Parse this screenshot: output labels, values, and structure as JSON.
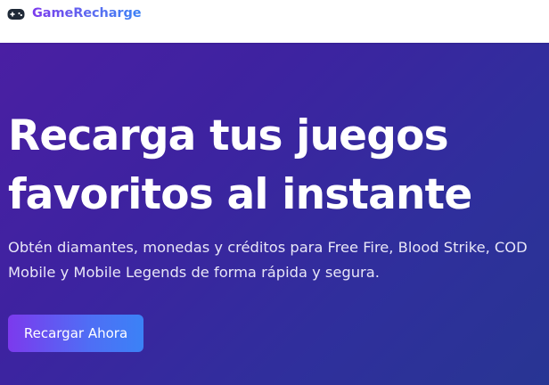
{
  "header": {
    "brand_name": "GameRecharge",
    "brand_icon": "gamepad-icon"
  },
  "hero": {
    "title": "Recarga tus juegos favoritos al instante",
    "subtitle": "Obtén diamantes, monedas y créditos para Free Fire, Blood Strike, COD Mobile y Mobile Legends de forma rápida y segura.",
    "cta_label": "Recargar Ahora"
  },
  "colors": {
    "brand_gradient_start": "#7c3aed",
    "brand_gradient_end": "#3b82f6",
    "hero_background_start": "#4a1fa3",
    "hero_background_end": "#283593",
    "hero_text": "#ffffff"
  }
}
